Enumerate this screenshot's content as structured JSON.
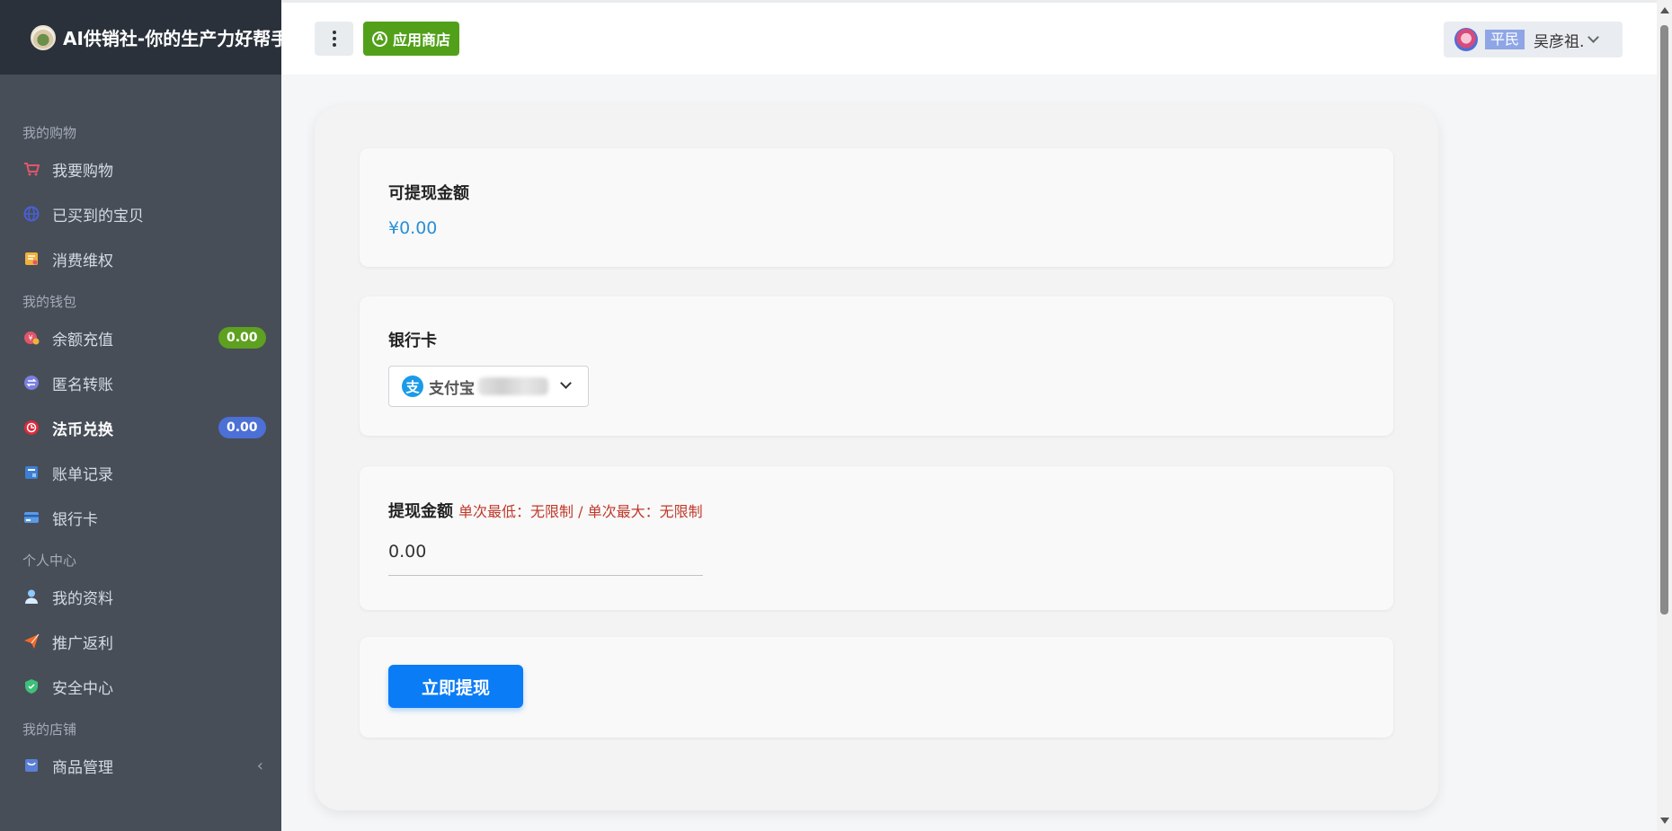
{
  "app": {
    "title": "AI供销社-你的生产力好帮手"
  },
  "header": {
    "store_label": "应用商店",
    "user_rank": "平民",
    "user_name": "吴彦祖."
  },
  "sidebar": {
    "groups": [
      {
        "title": "我的购物",
        "items": [
          {
            "label": "我要购物",
            "icon": "cart-icon"
          },
          {
            "label": "已买到的宝贝",
            "icon": "globe-icon"
          },
          {
            "label": "消费维权",
            "icon": "complaint-icon"
          }
        ]
      },
      {
        "title": "我的钱包",
        "items": [
          {
            "label": "余额充值",
            "icon": "recharge-icon",
            "badge": "0.00"
          },
          {
            "label": "匿名转账",
            "icon": "transfer-icon"
          },
          {
            "label": "法币兑换",
            "icon": "exchange-icon",
            "badge": "0.00",
            "active": true
          },
          {
            "label": "账单记录",
            "icon": "bill-icon"
          },
          {
            "label": "银行卡",
            "icon": "bankcard-icon"
          }
        ]
      },
      {
        "title": "个人中心",
        "items": [
          {
            "label": "我的资料",
            "icon": "user-icon"
          },
          {
            "label": "推广返利",
            "icon": "send-icon"
          },
          {
            "label": "安全中心",
            "icon": "shield-icon"
          }
        ]
      },
      {
        "title": "我的店铺",
        "items": [
          {
            "label": "商品管理",
            "icon": "goods-icon"
          }
        ]
      }
    ]
  },
  "withdraw": {
    "balance_title": "可提现金额",
    "balance_value": "¥0.00",
    "bank_title": "银行卡",
    "bank_selected": "支付宝",
    "amount_title": "提现金额",
    "amount_limit": "单次最低：无限制 / 单次最大：无限制",
    "amount_value": "0.00",
    "submit_label": "立即提现"
  },
  "colors": {
    "sidebar": "#474e58",
    "brand_bar": "#2a313b",
    "store_button": "#52a01a",
    "submit_button": "#0a7cf6",
    "amount": "#2b8fd6",
    "limit_text": "#c0392b"
  }
}
